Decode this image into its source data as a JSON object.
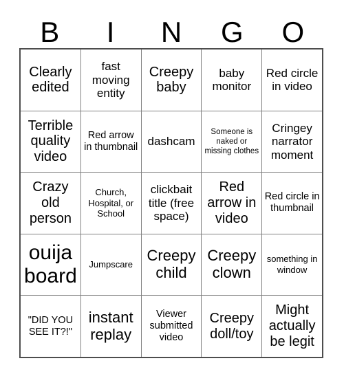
{
  "card": {
    "title": "BINGO",
    "headers": [
      "B",
      "I",
      "N",
      "G",
      "O"
    ],
    "grid_rows": 5,
    "grid_cols": 5,
    "free_space_index": 12,
    "colors": {
      "background": "#ffffff",
      "text": "#000000",
      "inner_border": "#808080",
      "outer_border": "#4d4d4d"
    },
    "cells": [
      {
        "text": "Clearly edited",
        "size": "lg"
      },
      {
        "text": "fast moving entity",
        "size": "md"
      },
      {
        "text": "Creepy baby",
        "size": "lg"
      },
      {
        "text": "baby monitor",
        "size": "md"
      },
      {
        "text": "Red circle in video",
        "size": "md"
      },
      {
        "text": "Terrible quality video",
        "size": "lg"
      },
      {
        "text": "Red arrow in thumbnail",
        "size": "sm"
      },
      {
        "text": "dashcam",
        "size": "md"
      },
      {
        "text": "Someone is naked or missing clothes",
        "size": "xxs"
      },
      {
        "text": "Cringey narrator moment",
        "size": "md"
      },
      {
        "text": "Crazy old person",
        "size": "lg"
      },
      {
        "text": "Church, Hospital, or School",
        "size": "xs"
      },
      {
        "text": "clickbait title (free space)",
        "size": "md"
      },
      {
        "text": "Red arrow in video",
        "size": "lg"
      },
      {
        "text": "Red circle in thumbnail",
        "size": "sm"
      },
      {
        "text": "ouija board",
        "size": "xxl"
      },
      {
        "text": "Jumpscare",
        "size": "xs"
      },
      {
        "text": "Creepy child",
        "size": "xl"
      },
      {
        "text": "Creepy clown",
        "size": "xl"
      },
      {
        "text": "something in window",
        "size": "xs"
      },
      {
        "text": "\"DID YOU SEE IT?!\"",
        "size": "sm"
      },
      {
        "text": "instant replay",
        "size": "xl"
      },
      {
        "text": "Viewer submitted video",
        "size": "sm"
      },
      {
        "text": "Creepy doll/toy",
        "size": "lg"
      },
      {
        "text": "Might actually be legit",
        "size": "lg"
      }
    ]
  }
}
